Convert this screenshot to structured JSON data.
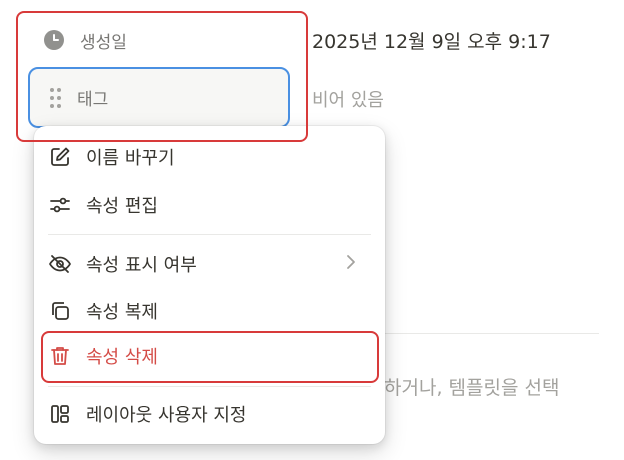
{
  "properties": {
    "created": {
      "label": "생성일",
      "value": "2025년 12월 9일 오후 9:17"
    },
    "tag": {
      "label": "태그",
      "placeholder": "비어 있음"
    }
  },
  "menu": {
    "items": [
      {
        "label": "이름 바꾸기",
        "icon": "edit-icon"
      },
      {
        "label": "속성 편집",
        "icon": "sliders-icon"
      },
      {
        "label": "속성 표시 여부",
        "icon": "eye-off-icon",
        "has_submenu": true
      },
      {
        "label": "속성 복제",
        "icon": "duplicate-icon"
      },
      {
        "label": "속성 삭제",
        "icon": "trash-icon",
        "danger": true
      },
      {
        "label": "레이아웃 사용자 지정",
        "icon": "layout-icon"
      }
    ]
  },
  "background": {
    "text": "하거나, 템플릿을 선택"
  },
  "colors": {
    "accent": "#4a90e2",
    "danger": "#d44c47",
    "highlight": "#d83a3a"
  }
}
